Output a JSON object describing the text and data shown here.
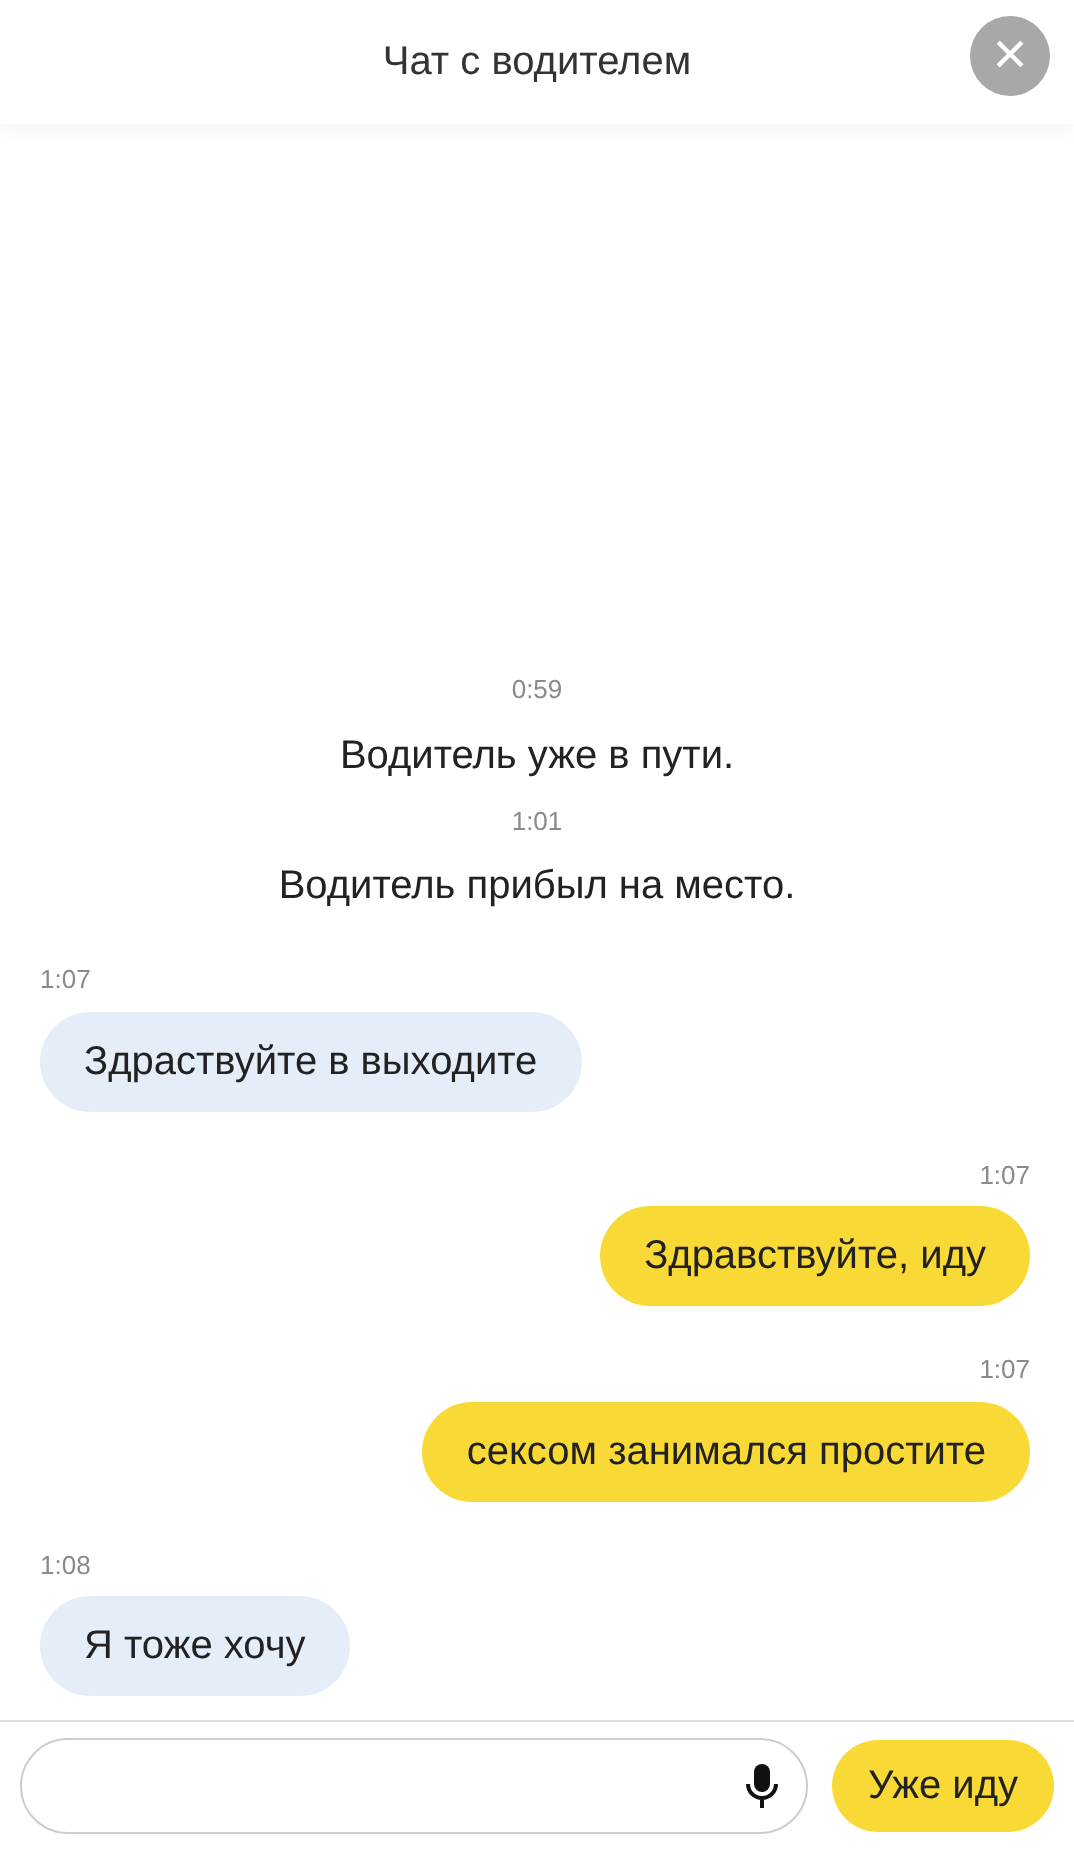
{
  "header": {
    "title": "Чат с водителем",
    "close": "×"
  },
  "messages": [
    {
      "kind": "system",
      "time": "0:59",
      "text": "Водитель уже в пути."
    },
    {
      "kind": "system",
      "time": "1:01",
      "text": "Водитель прибыл на место."
    },
    {
      "kind": "incoming",
      "time": "1:07",
      "text": "Здраствуйте в выходите"
    },
    {
      "kind": "outgoing",
      "time": "1:07",
      "text": "Здравствуйте, иду"
    },
    {
      "kind": "outgoing",
      "time": "1:07",
      "text": "сексом занимался простите"
    },
    {
      "kind": "incoming",
      "time": "1:08",
      "text": "Я тоже хочу"
    }
  ],
  "composer": {
    "quick_reply": "Уже иду"
  }
}
